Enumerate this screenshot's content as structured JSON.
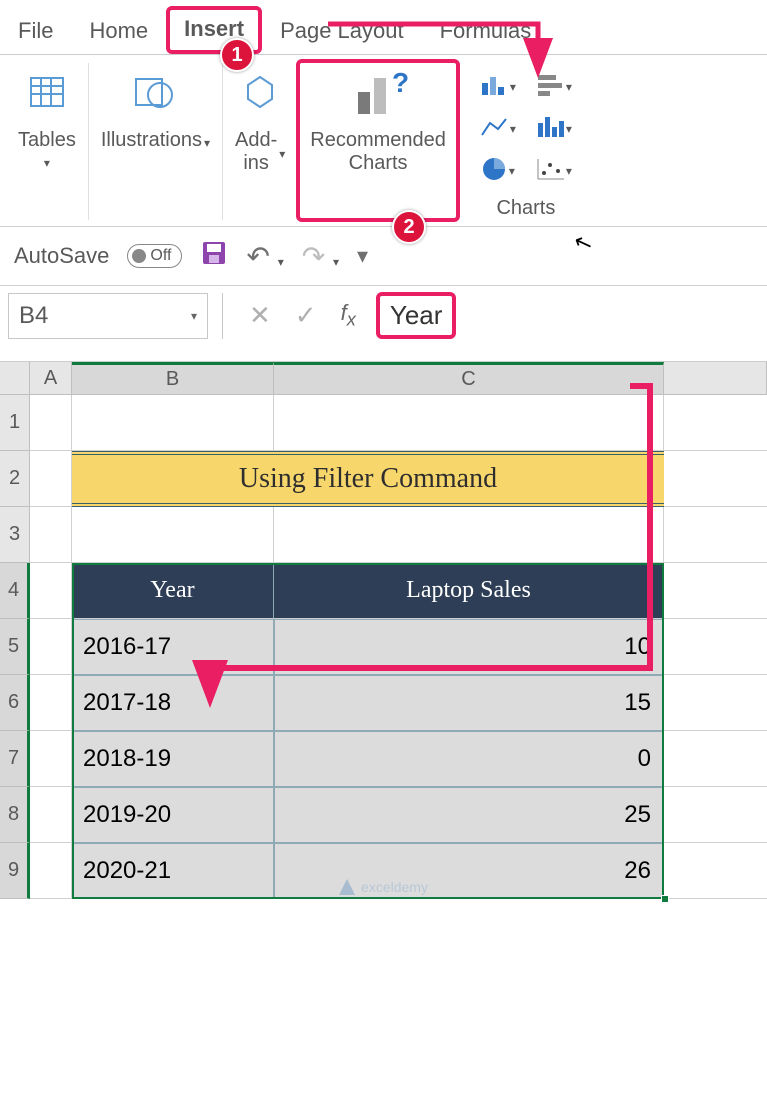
{
  "tabs": {
    "file": "File",
    "home": "Home",
    "insert": "Insert",
    "pageLayout": "Page Layout",
    "formulas": "Formulas"
  },
  "ribbon": {
    "tables": "Tables",
    "illustrations": "Illustrations",
    "addins": "Add-\nins",
    "recommended": "Recommended\nCharts",
    "charts": "Charts"
  },
  "qat": {
    "autosave": "AutoSave",
    "off": "Off"
  },
  "nameBox": "B4",
  "formulaValue": "Year",
  "colHeaders": {
    "a": "A",
    "b": "B",
    "c": "C"
  },
  "rowHeaders": [
    "1",
    "2",
    "3",
    "4",
    "5",
    "6",
    "7",
    "8",
    "9"
  ],
  "title": "Using Filter Command",
  "headers": {
    "year": "Year",
    "sales": "Laptop Sales"
  },
  "tableRows": [
    {
      "year": "2016-17",
      "sales": "10"
    },
    {
      "year": "2017-18",
      "sales": "15"
    },
    {
      "year": "2018-19",
      "sales": "0"
    },
    {
      "year": "2019-20",
      "sales": "25"
    },
    {
      "year": "2020-21",
      "sales": "26"
    }
  ],
  "badges": {
    "b1": "1",
    "b2": "2"
  },
  "watermark": "exceldemy",
  "chart_data": {
    "type": "table",
    "title": "Using Filter Command",
    "columns": [
      "Year",
      "Laptop Sales"
    ],
    "rows": [
      [
        "2016-17",
        10
      ],
      [
        "2017-18",
        15
      ],
      [
        "2018-19",
        0
      ],
      [
        "2019-20",
        25
      ],
      [
        "2020-21",
        26
      ]
    ]
  }
}
